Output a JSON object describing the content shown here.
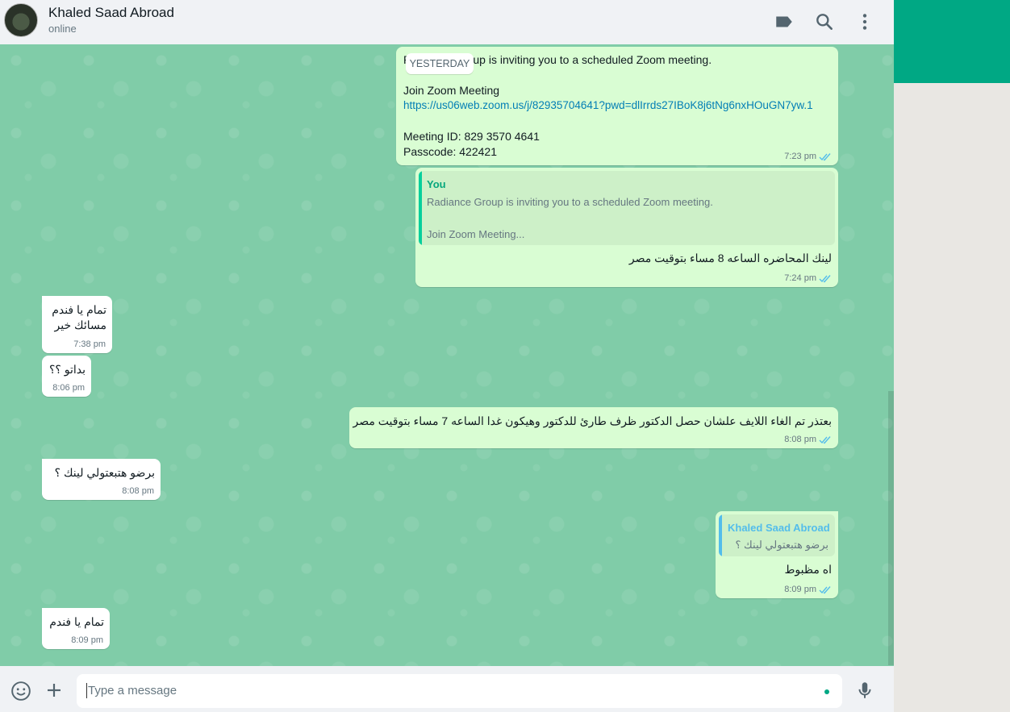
{
  "header": {
    "contact_name": "Khaled Saad Abroad",
    "status": "online"
  },
  "date_divider": "YESTERDAY",
  "messages": {
    "m1": {
      "line1": "Radiance Group is inviting you to a scheduled Zoom meeting.",
      "line2": "Join Zoom Meeting",
      "link": "https://us06web.zoom.us/j/82935704641?pwd=dlIrrds27IBoK8j6tNg6nxHOuGN7yw.1",
      "line3": "Meeting ID: 829 3570 4641",
      "line4": "Passcode: 422421",
      "time": "7:23 pm"
    },
    "m2": {
      "quote_author": "You",
      "quote_line1": "Radiance Group is inviting you to a scheduled Zoom meeting.",
      "quote_line2": "Join Zoom Meeting...",
      "text": "لينك المحاضره الساعه 8 مساء بتوقيت مصر",
      "time": "7:24 pm"
    },
    "m3": {
      "line1": "تمام يا فندم",
      "line2": "مسائك خير",
      "time": "7:38 pm"
    },
    "m4": {
      "text": "بداتو ؟؟",
      "time": "8:06 pm"
    },
    "m5": {
      "text": "بعتذر تم الغاء اللايف علشان حصل الدكتور ظرف طارئ للدكتور وهيكون غدا الساعه 7 مساء بتوقيت مصر",
      "time": "8:08 pm"
    },
    "m6": {
      "text": "برضو هتبعتولي لينك ؟",
      "time": "8:08 pm"
    },
    "m7": {
      "quote_author": "Khaled Saad Abroad",
      "quote_text": "برضو هتبعتولي لينك ؟",
      "text": "اه مظبوط",
      "time": "8:09 pm"
    },
    "m8": {
      "text": "تمام يا فندم",
      "time": "8:09 pm"
    }
  },
  "composer": {
    "placeholder": "Type a message"
  },
  "icons": {
    "header": [
      "label-icon",
      "search-icon",
      "menu-icon"
    ],
    "footer": [
      "emoji-icon",
      "attach-icon",
      "mic-icon"
    ]
  },
  "colors": {
    "outgoing": "#d9fdd3",
    "incoming": "#ffffff",
    "accent": "#00a884",
    "link": "#027eb5",
    "read_ticks": "#53bdeb"
  }
}
